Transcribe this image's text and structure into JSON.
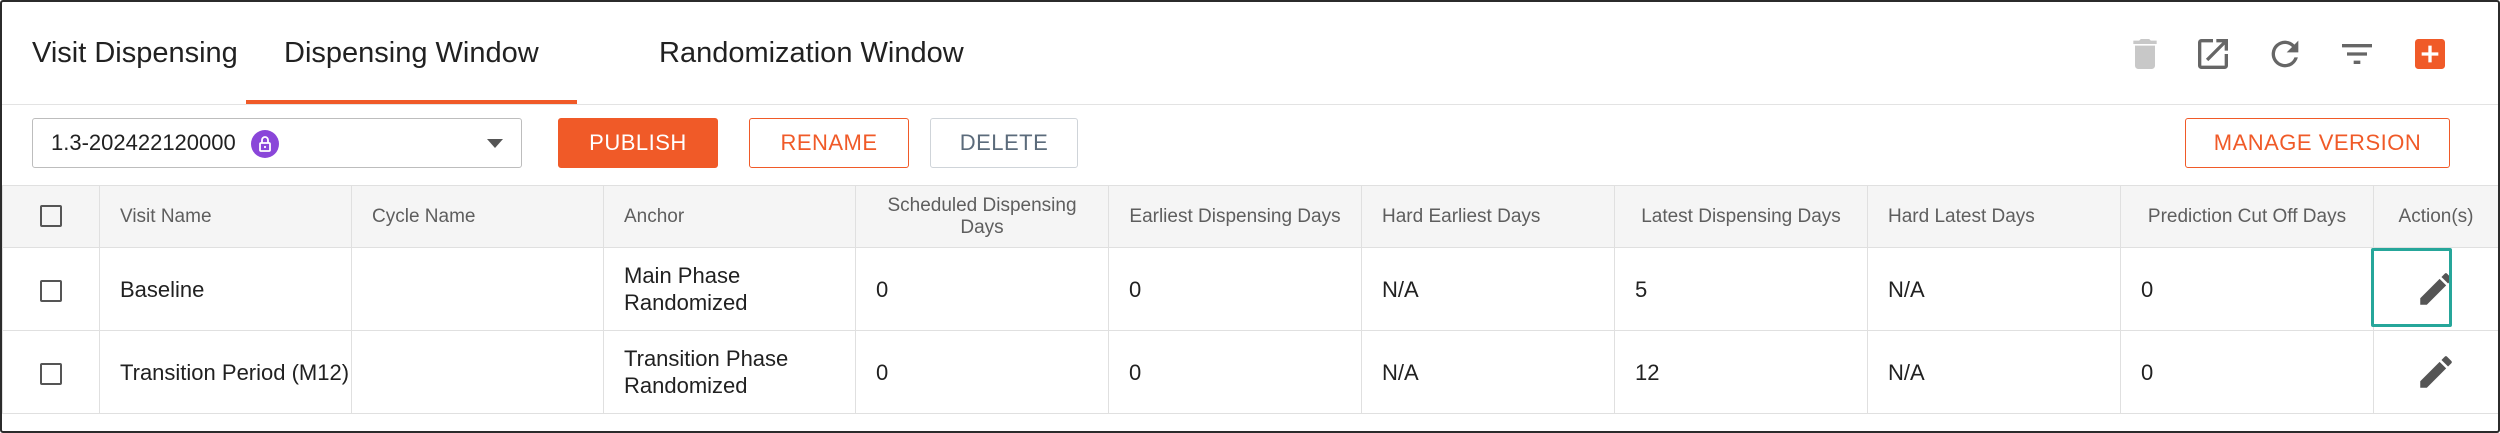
{
  "tabs": [
    {
      "label": "Visit Dispensing",
      "active": false
    },
    {
      "label": "Dispensing Window",
      "active": true
    },
    {
      "label": "Randomization Window",
      "active": false
    }
  ],
  "toolbar_icons": [
    "trash-icon",
    "open-external-icon",
    "refresh-icon",
    "filter-icon",
    "add-icon"
  ],
  "version_select": {
    "value": "1.3-202422120000",
    "locked": true
  },
  "buttons": {
    "publish": "PUBLISH",
    "rename": "RENAME",
    "delete": "DELETE",
    "manage_version": "MANAGE VERSION"
  },
  "table": {
    "columns": [
      "Visit Name",
      "Cycle Name",
      "Anchor",
      "Scheduled Dispensing Days",
      "Earliest Dispensing Days",
      "Hard Earliest Days",
      "Latest Dispensing Days",
      "Hard Latest Days",
      "Prediction Cut Off Days",
      "Action(s)"
    ],
    "rows": [
      {
        "visit_name": "Baseline",
        "cycle_name": "",
        "anchor": "Main Phase Randomized",
        "scheduled": "0",
        "earliest": "0",
        "hard_earliest": "N/A",
        "latest": "5",
        "hard_latest": "N/A",
        "prediction_cutoff": "0",
        "highlighted": true
      },
      {
        "visit_name": "Transition Period (M12)",
        "cycle_name": "",
        "anchor": "Transition Phase Randomized",
        "scheduled": "0",
        "earliest": "0",
        "hard_earliest": "N/A",
        "latest": "12",
        "hard_latest": "N/A",
        "prediction_cutoff": "0",
        "highlighted": false
      }
    ]
  },
  "colors": {
    "accent": "#f05a28",
    "highlight": "#26a69a",
    "lock_badge": "#8a46d9"
  }
}
